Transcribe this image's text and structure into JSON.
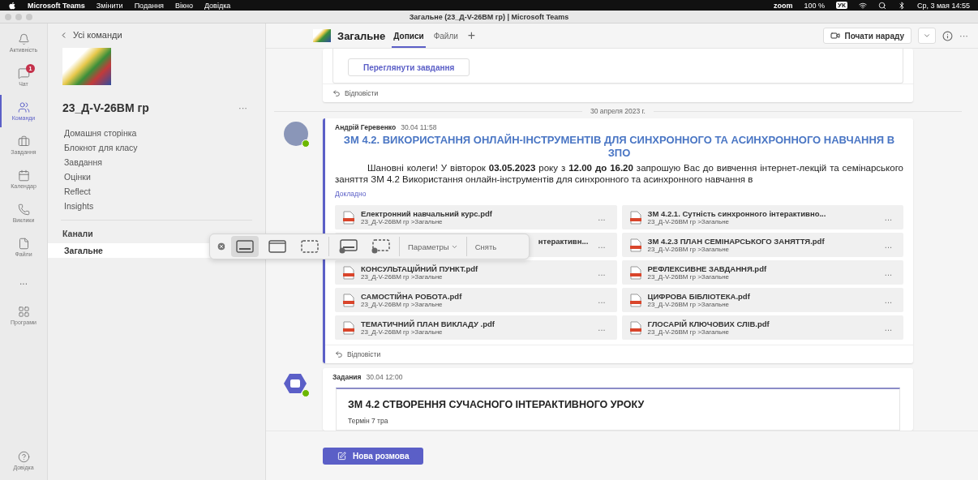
{
  "menubar": {
    "app": "Microsoft Teams",
    "menus": [
      "Змінити",
      "Подання",
      "Вікно",
      "Довідка"
    ],
    "zoom": "zoom",
    "battery": "100 %",
    "keyboard": "УК",
    "clock": "Ср, 3 мая 14:55"
  },
  "window": {
    "title": "Загальне (23_Д-V-26ВМ гр) | Microsoft Teams"
  },
  "rail": {
    "items": [
      {
        "kind": "bell",
        "label": "Активність",
        "selected": false
      },
      {
        "kind": "chat",
        "label": "Чат",
        "selected": false,
        "badge": "1"
      },
      {
        "kind": "teams",
        "label": "Команди",
        "selected": true
      },
      {
        "kind": "bag",
        "label": "Завдання",
        "selected": false
      },
      {
        "kind": "calendar",
        "label": "Календар",
        "selected": false
      },
      {
        "kind": "phone",
        "label": "Виклики",
        "selected": false
      },
      {
        "kind": "file",
        "label": "Файли",
        "selected": false
      },
      {
        "kind": "more",
        "label": "...",
        "selected": false
      },
      {
        "kind": "apps",
        "label": "Програми",
        "selected": false
      }
    ],
    "help": "Довідка"
  },
  "team_panel": {
    "back": "Усі команди",
    "team_name": "23_Д-V-26ВМ гр",
    "more": "···",
    "nav": [
      "Домашня сторінка",
      "Блокнот для класу",
      "Завдання",
      "Оцінки",
      "Reflect",
      "Insights"
    ],
    "channels_heading": "Канали",
    "channels": [
      {
        "name": "Загальне",
        "selected": true
      }
    ]
  },
  "header": {
    "channel": "Загальне",
    "tabs": [
      {
        "label": "Дописи",
        "selected": true
      },
      {
        "label": "Файли",
        "selected": false
      }
    ],
    "add": "+",
    "meet_button": "Почати нараду",
    "more": "···"
  },
  "feed": {
    "prev_card": {
      "button": "Переглянути завдання",
      "reply": "Відповісти"
    },
    "date": "30 апреля 2023 г.",
    "message": {
      "author": "Андрій Геревенко",
      "time": "30.04 11:58",
      "title": "ЗМ 4.2. ВИКОРИСТАННЯ ОНЛАЙН-ІНСТРУМЕНТІВ ДЛЯ СИНХРОННОГО ТА АСИНХРОННОГО НАВЧАННЯ В ЗПО",
      "body": "Шановні колеги! У вівторок **03.05.2023** року з **12.00 до 16.20** запрошую Вас до вивчення інтернет-лекцій та семінарського заняття ЗМ 4.2 Використання онлайн-інструментів для синхронного та асинхронного навчання в",
      "more": "Докладно",
      "files": [
        {
          "kind": "full",
          "name": "Електронний навчальний курс.pdf",
          "path": "23_Д-V-26ВМ гр >Загальне",
          "more": "..."
        },
        {
          "kind": "full",
          "name": "ЗМ 4.2.1. Сутність синхронного інтерактивно...",
          "path": "23_Д-V-26ВМ гр >Загальне",
          "more": "..."
        },
        {
          "kind": "partial",
          "name": "нтерактивн...",
          "more": "..."
        },
        {
          "kind": "full",
          "name": "ЗМ 4.2.3 ПЛАН СЕМІНАРСЬКОГО ЗАНЯТТЯ.pdf",
          "path": "23_Д-V-26ВМ гр >Загальне",
          "more": "..."
        },
        {
          "kind": "full",
          "name": "КОНСУЛЬТАЦІЙНИЙ ПУНКТ.pdf",
          "path": "23_Д-V-26ВМ гр >Загальне",
          "more": "..."
        },
        {
          "kind": "full",
          "name": "РЕФЛЕКСИВНЕ ЗАВДАННЯ.pdf",
          "path": "23_Д-V-26ВМ гр >Загальне",
          "more": "..."
        },
        {
          "kind": "full",
          "name": "САМОСТІЙНА РОБОТА.pdf",
          "path": "23_Д-V-26ВМ гр >Загальне",
          "more": "..."
        },
        {
          "kind": "full",
          "name": "ЦИФРОВА БІБЛІОТЕКА.pdf",
          "path": "23_Д-V-26ВМ гр >Загальне",
          "more": "..."
        },
        {
          "kind": "full",
          "name": "ТЕМАТИЧНИЙ ПЛАН ВИКЛАДУ .pdf",
          "path": "23_Д-V-26ВМ гр >Загальне",
          "more": "..."
        },
        {
          "kind": "full",
          "name": "ГЛОСАРІЙ КЛЮЧОВИХ СЛІВ.pdf",
          "path": "23_Д-V-26ВМ гр >Загальне",
          "more": "..."
        }
      ],
      "reply": "Відповісти"
    },
    "task": {
      "author": "Задания",
      "time": "30.04 12:00",
      "title": "ЗМ 4.2 СТВОРЕННЯ СУЧАСНОГО ІНТЕРАКТИВНОГО УРОКУ",
      "due": "Термін 7 тра"
    },
    "new_post": "Нова розмова"
  },
  "capture_toolbar": {
    "tools": [
      {
        "kind": "screen",
        "selected": true
      },
      {
        "kind": "window",
        "selected": false
      },
      {
        "kind": "selection",
        "selected": false
      },
      {
        "kind": "record-screen",
        "selected": false
      },
      {
        "kind": "record-selection",
        "selected": false
      }
    ],
    "options": "Параметры",
    "capture": "Снять"
  }
}
